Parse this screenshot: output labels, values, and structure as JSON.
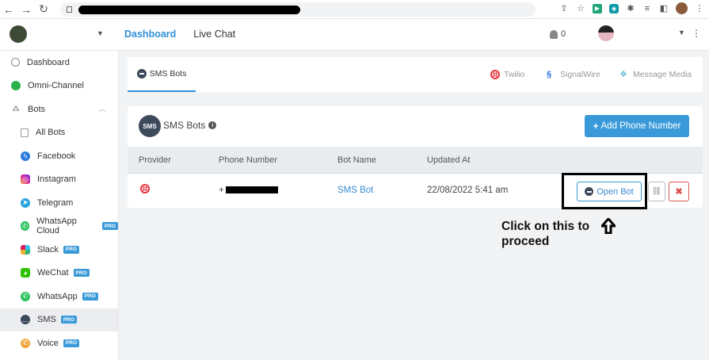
{
  "browser": {
    "back_glyph": "←",
    "forward_glyph": "→",
    "reload_glyph": "↻",
    "icons": [
      "share-icon",
      "star-icon",
      "extension-green-icon",
      "extension-teal-icon",
      "puzzle-icon",
      "reading-list-icon",
      "sidebar-icon",
      "profile-avatar",
      "menu-dots-icon"
    ]
  },
  "header": {
    "nav": {
      "dashboard": "Dashboard",
      "live_chat": "Live Chat"
    },
    "notifications_count": "0"
  },
  "sidebar": {
    "items": [
      {
        "label": "Dashboard",
        "icon": "dashboard-icon"
      },
      {
        "label": "Omni-Channel",
        "icon": "chat-bubbles-icon"
      },
      {
        "label": "Bots",
        "icon": "bots-icon"
      },
      {
        "label": "All Bots",
        "icon": "list-icon"
      },
      {
        "label": "Facebook",
        "icon": "messenger-icon"
      },
      {
        "label": "Instagram",
        "icon": "instagram-icon"
      },
      {
        "label": "Telegram",
        "icon": "telegram-icon"
      },
      {
        "label": "WhatsApp Cloud",
        "icon": "whatsapp-icon",
        "badge": "PRO"
      },
      {
        "label": "Slack",
        "icon": "slack-icon",
        "badge": "PRO"
      },
      {
        "label": "WeChat",
        "icon": "wechat-icon",
        "badge": "PRO"
      },
      {
        "label": "WhatsApp",
        "icon": "whatsapp-icon",
        "badge": "PRO"
      },
      {
        "label": "SMS",
        "icon": "sms-icon",
        "badge": "PRO"
      },
      {
        "label": "Voice",
        "icon": "voice-icon",
        "badge": "PRO"
      }
    ]
  },
  "tabs": {
    "sms_bots": "SMS Bots",
    "providers": [
      "Twilio",
      "SignalWire",
      "Message Media"
    ]
  },
  "card": {
    "badge": "SMS",
    "title": "SMS Bots",
    "add_button": "Add Phone Number",
    "add_plus": "+"
  },
  "table": {
    "headers": [
      "Provider",
      "Phone Number",
      "Bot Name",
      "Updated At"
    ],
    "rows": [
      {
        "provider_icon": "twilio-icon",
        "phone_prefix": "+",
        "bot_name": "SMS Bot",
        "updated_at": "22/08/2022 5:41 am"
      }
    ],
    "actions": {
      "open_bot": "Open Bot",
      "unlink_glyph": "⛓",
      "delete_glyph": "✖"
    }
  },
  "callout": {
    "text": "Click on this to proceed"
  },
  "colors": {
    "accent": "#3a9ad9",
    "link": "#2f8fd8",
    "danger": "#d9534f",
    "twilio": "#e8333b",
    "pro_badge": "#3a9ad9"
  }
}
